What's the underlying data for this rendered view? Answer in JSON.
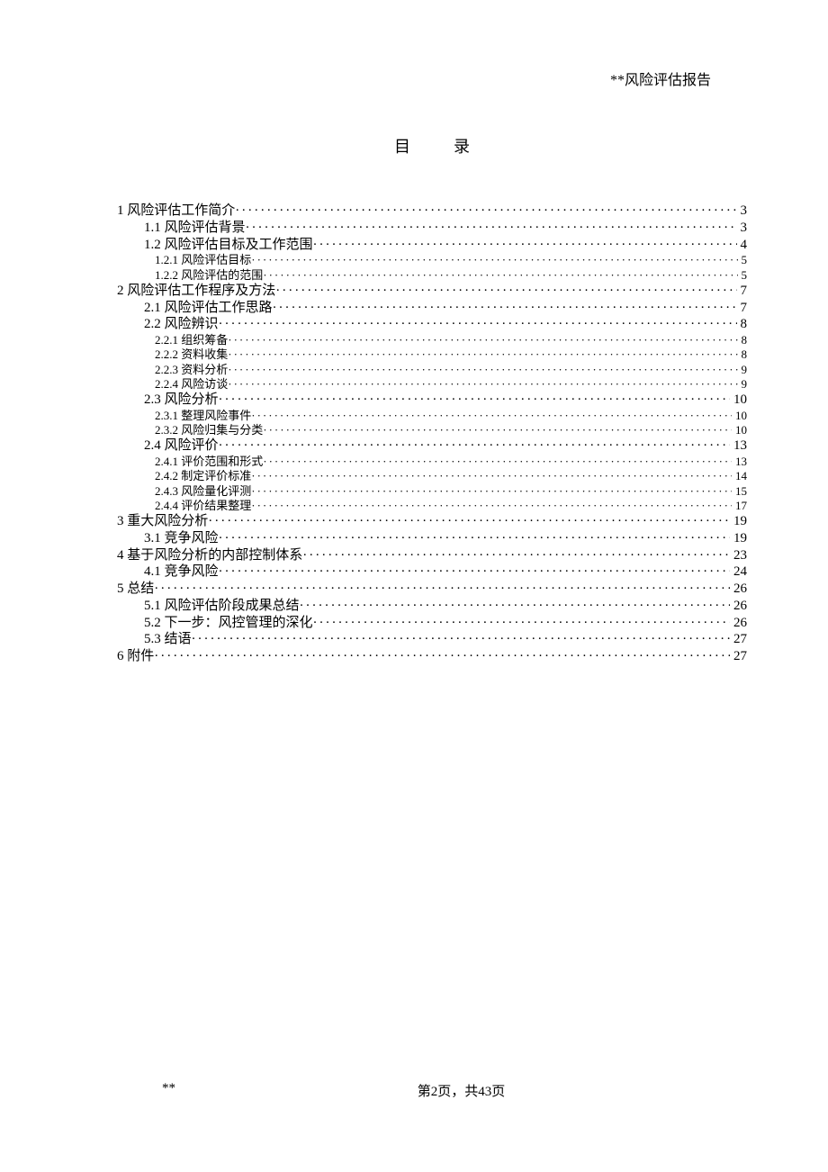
{
  "header": "**风险评估报告",
  "toc_title": "目录",
  "dots_long": "···································································································································································",
  "entries": [
    {
      "lvl": 0,
      "label": "1 风险评估工作简介",
      "page": "3",
      "small": false
    },
    {
      "lvl": 1,
      "label": "1.1 风险评估背景",
      "page": "3",
      "small": false
    },
    {
      "lvl": 1,
      "label": "1.2 风险评估目标及工作范围",
      "page": "4",
      "small": false
    },
    {
      "lvl": 2,
      "label": "1.2.1 风险评估目标",
      "page": "5",
      "small": true
    },
    {
      "lvl": 2,
      "label": "1.2.2 风险评估的范围",
      "page": "5",
      "small": true
    },
    {
      "lvl": 0,
      "label": "2 风险评估工作程序及方法",
      "page": "7",
      "small": false
    },
    {
      "lvl": 1,
      "label": "2.1 风险评估工作思路",
      "page": "7",
      "small": false
    },
    {
      "lvl": 1,
      "label": "2.2 风险辨识",
      "page": "8",
      "small": false
    },
    {
      "lvl": 2,
      "label": "2.2.1 组织筹备",
      "page": "8",
      "small": true
    },
    {
      "lvl": 2,
      "label": "2.2.2 资料收集",
      "page": "8",
      "small": true
    },
    {
      "lvl": 2,
      "label": "2.2.3 资料分析",
      "page": "9",
      "small": true
    },
    {
      "lvl": 2,
      "label": "2.2.4 风险访谈",
      "page": "9",
      "small": true
    },
    {
      "lvl": 1,
      "label": "2.3 风险分析",
      "page": "10",
      "small": false
    },
    {
      "lvl": 2,
      "label": "2.3.1 整理风险事件",
      "page": "10",
      "small": true
    },
    {
      "lvl": 2,
      "label": "2.3.2 风险归集与分类",
      "page": "10",
      "small": true
    },
    {
      "lvl": 1,
      "label": "2.4 风险评价",
      "page": "13",
      "small": false
    },
    {
      "lvl": 2,
      "label": "2.4.1 评价范围和形式",
      "page": "13",
      "small": true
    },
    {
      "lvl": 2,
      "label": "2.4.2 制定评价标准",
      "page": "14",
      "small": true
    },
    {
      "lvl": 2,
      "label": "2.4.3 风险量化评测",
      "page": "15",
      "small": true
    },
    {
      "lvl": 2,
      "label": "2.4.4 评价结果整理",
      "page": "17",
      "small": true
    },
    {
      "lvl": 0,
      "label": "3 重大风险分析",
      "page": "19",
      "small": false
    },
    {
      "lvl": 1,
      "label": "3.1 竞争风险",
      "page": "19",
      "small": false
    },
    {
      "lvl": 0,
      "label": "4 基于风险分析的内部控制体系",
      "page": "23",
      "small": false
    },
    {
      "lvl": 1,
      "label": "4.1 竞争风险",
      "page": "24",
      "small": false
    },
    {
      "lvl": 0,
      "label": "5 总结",
      "page": "26",
      "small": false
    },
    {
      "lvl": 1,
      "label": "5.1 风险评估阶段成果总结",
      "page": "26",
      "small": false
    },
    {
      "lvl": 1,
      "label": "5.2 下一步：风控管理的深化",
      "page": "26",
      "small": false
    },
    {
      "lvl": 1,
      "label": "5.3 结语",
      "page": "27",
      "small": false
    },
    {
      "lvl": 0,
      "label": "6 附件",
      "page": "27",
      "small": false
    }
  ],
  "footer": {
    "left": "**",
    "center": "第2页，共43页"
  }
}
